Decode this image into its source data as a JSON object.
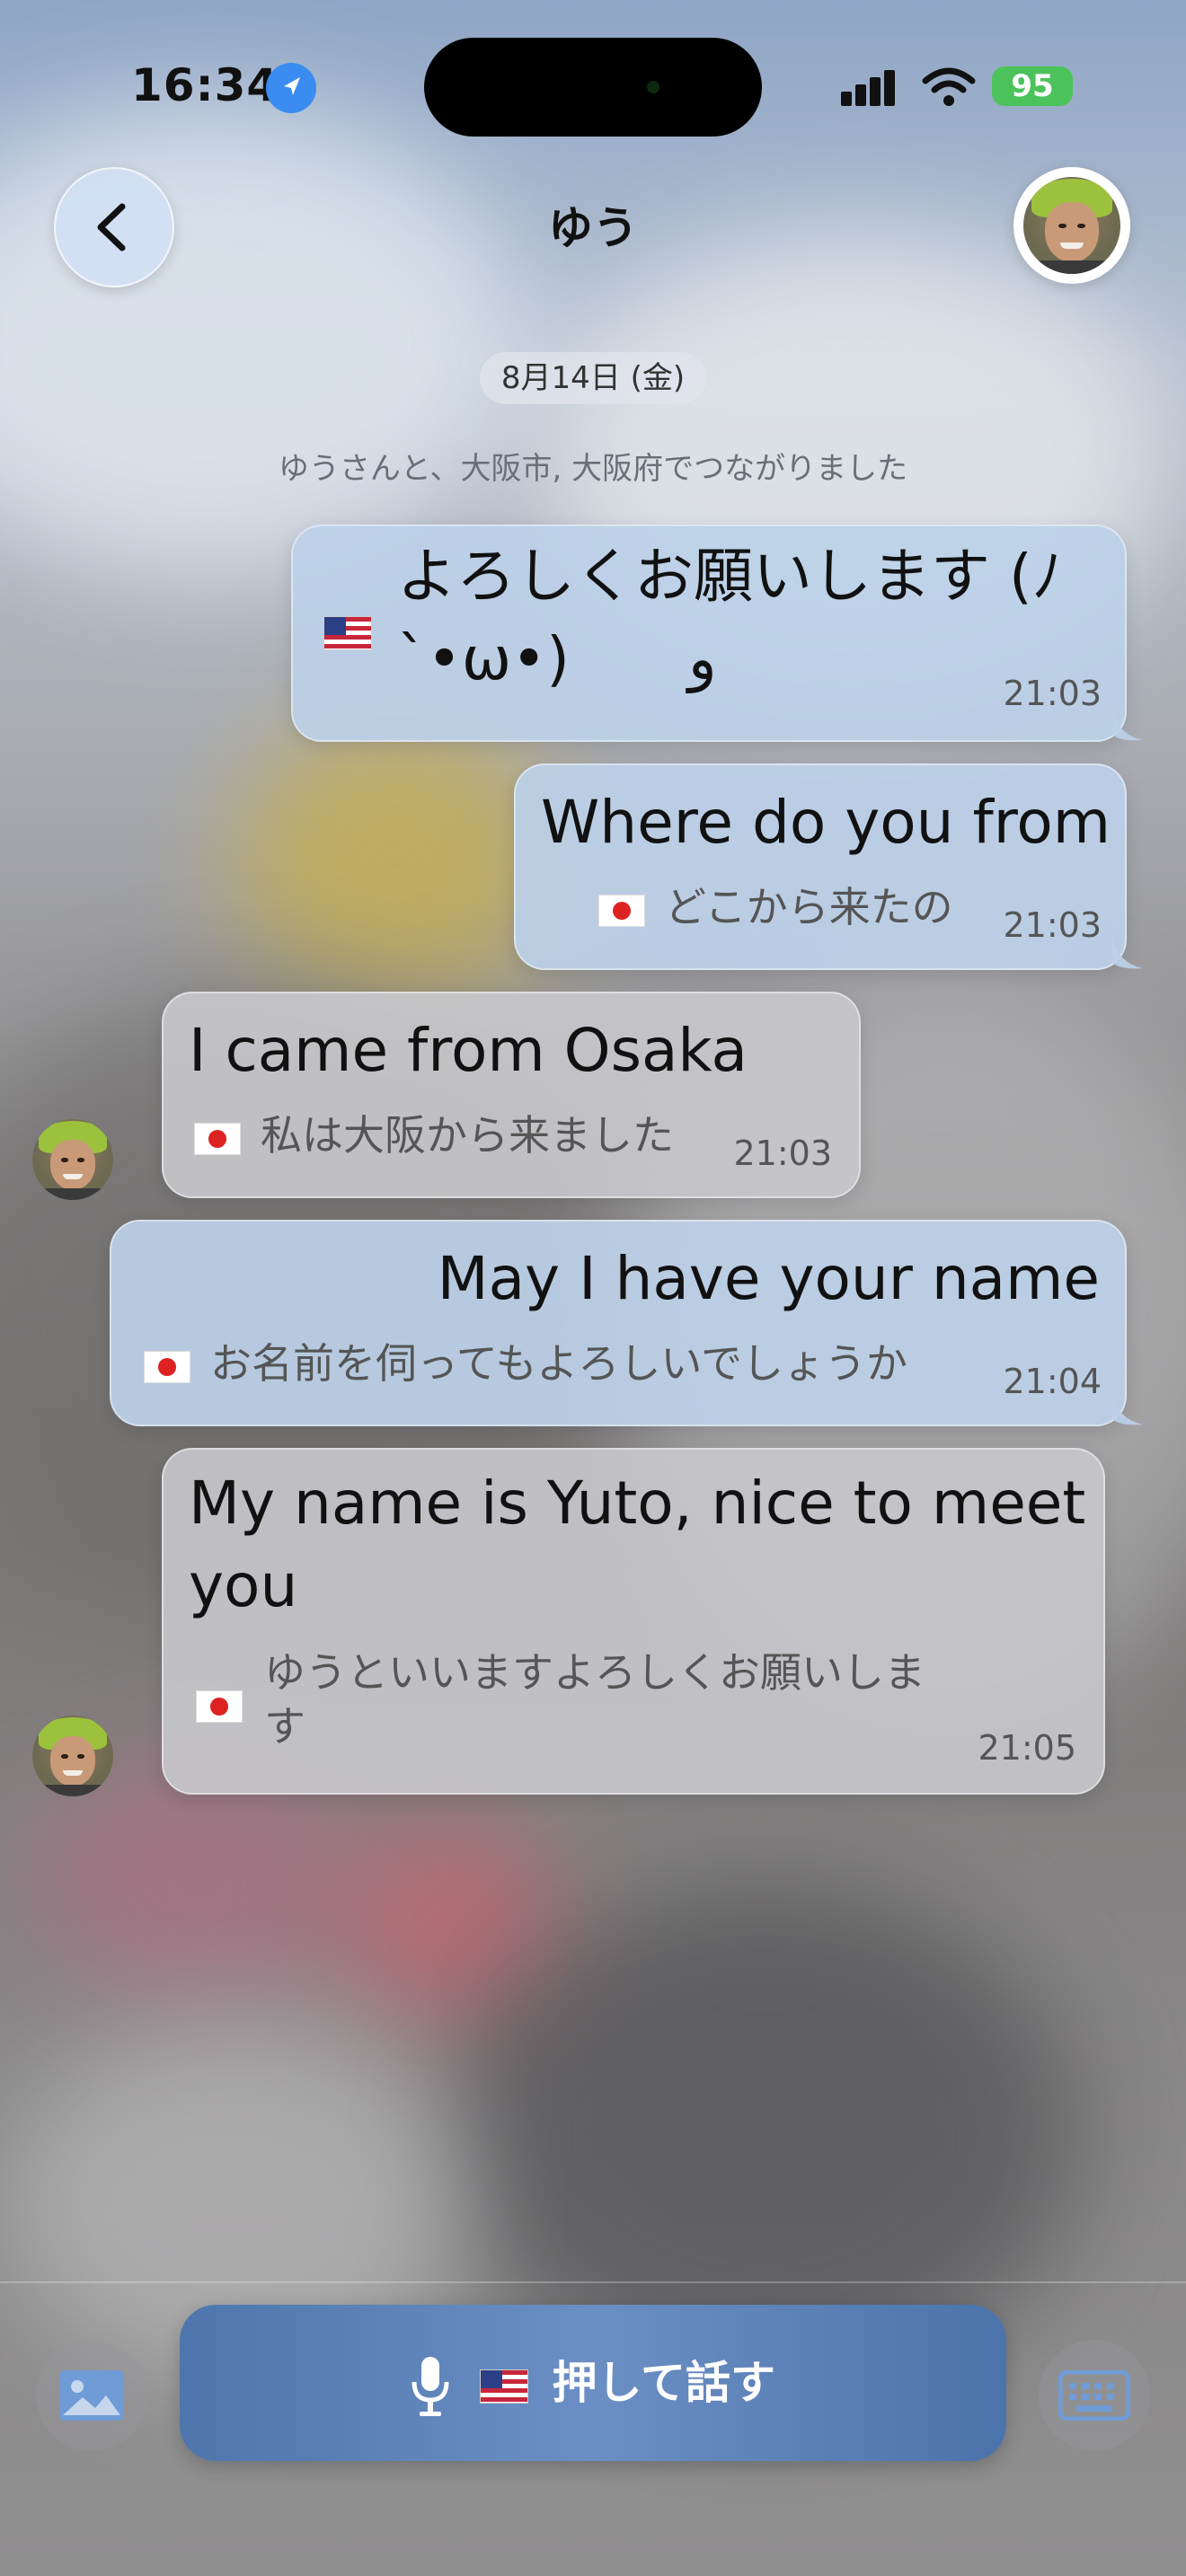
{
  "status_bar": {
    "time": "16:34",
    "battery": "95"
  },
  "header": {
    "title": "ゆう"
  },
  "date_pill": "8月14日 (金)",
  "system_message": "ゆうさんと、大阪市, 大阪府でつながりました",
  "messages": [
    {
      "direction": "out",
      "flag": "us",
      "line1": "よろしくお願いします (ﾉ",
      "line2": "`•ω•)　　و",
      "translation": "",
      "time": "21:03"
    },
    {
      "direction": "out",
      "flag": "jp",
      "text": "Where do you from",
      "translation": "どこから来たの",
      "time": "21:03"
    },
    {
      "direction": "in",
      "flag": "jp",
      "text": "I came from Osaka",
      "translation": "私は大阪から来ました",
      "time": "21:03"
    },
    {
      "direction": "out",
      "flag": "jp",
      "text": "May I have your name",
      "translation": "お名前を伺ってもよろしいでしょうか",
      "time": "21:04"
    },
    {
      "direction": "in",
      "flag": "jp",
      "line1": "My name is Yuto, nice to meet",
      "line2": "you",
      "translation_line1": "ゆうといいますよろしくお願いしま",
      "translation_line2": "す",
      "time": "21:05"
    }
  ],
  "bottom_bar": {
    "push_to_talk_label": "押して話す"
  }
}
